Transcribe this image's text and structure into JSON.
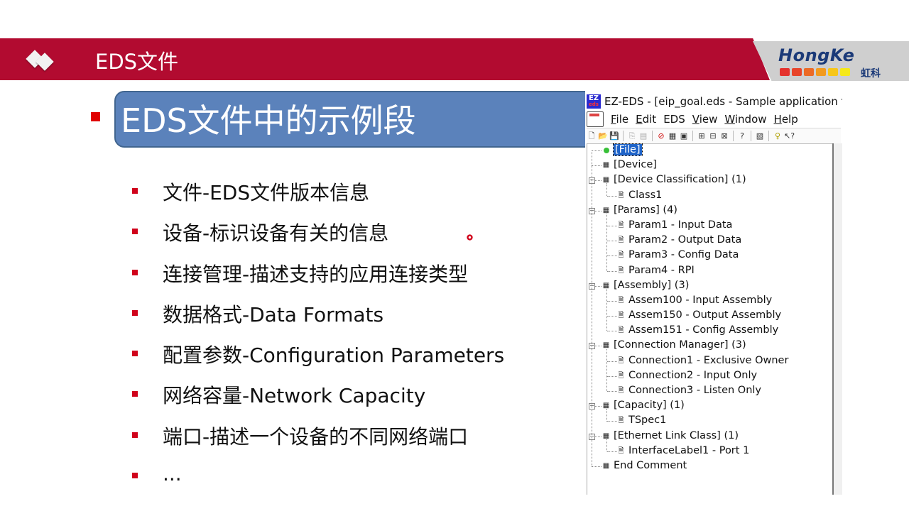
{
  "slide": {
    "section_title": "EDS文件",
    "heading": "EDS文件中的示例段",
    "bullets": [
      "文件-EDS文件版本信息",
      "设备-标识设备有关的信息",
      "连接管理-描述支持的应用连接类型",
      "数据格式-Data Formats",
      "配置参数-Configuration Parameters",
      "网络容量-Network Capacity",
      "端口-描述一个设备的不同网络端口",
      "..."
    ],
    "logo": {
      "text": "HongKe",
      "cn_text": "虹科",
      "bar_colors": [
        "#e5322d",
        "#e8452a",
        "#ec6a25",
        "#f29a1e",
        "#f7c61a",
        "#f5e91a"
      ]
    },
    "colors": {
      "banner": "#b20b30",
      "heading_box": "#5b82bb",
      "bullet": "#d0021b"
    }
  },
  "window": {
    "app_icon_top": "EZ",
    "app_icon_bottom": "eds",
    "title": "EZ-EDS - [eip_goal.eds - Sample application for",
    "menu": [
      {
        "key": "F",
        "rest": "ile"
      },
      {
        "key": "E",
        "rest": "dit"
      },
      {
        "key": "",
        "rest": "EDS"
      },
      {
        "key": "V",
        "rest": "iew"
      },
      {
        "key": "W",
        "rest": "indow"
      },
      {
        "key": "H",
        "rest": "elp"
      }
    ],
    "toolbar": [
      {
        "name": "new-file-icon",
        "glyph": "🗋",
        "enabled": true
      },
      {
        "name": "open-folder-icon",
        "glyph": "📂",
        "enabled": true
      },
      {
        "name": "save-icon",
        "glyph": "💾",
        "enabled": true
      },
      {
        "name": "copy-icon",
        "glyph": "⎘",
        "enabled": false
      },
      {
        "name": "paste-icon",
        "glyph": "▤",
        "enabled": false
      },
      {
        "name": "delete-icon",
        "glyph": "⊘",
        "enabled": true
      },
      {
        "name": "copy-item-icon",
        "glyph": "▦",
        "enabled": true
      },
      {
        "name": "paste-item-icon",
        "glyph": "▣",
        "enabled": true
      },
      {
        "name": "add-class-icon",
        "glyph": "⊞",
        "enabled": true
      },
      {
        "name": "add-item-icon",
        "glyph": "⊟",
        "enabled": true
      },
      {
        "name": "add-vendor-icon",
        "glyph": "⊠",
        "enabled": true
      },
      {
        "name": "help-topic-icon",
        "glyph": "?",
        "enabled": true
      },
      {
        "name": "view-icon",
        "glyph": "▧",
        "enabled": true
      },
      {
        "name": "about-icon",
        "glyph": "♀",
        "enabled": true
      },
      {
        "name": "context-help-icon",
        "glyph": "↖?",
        "enabled": true
      }
    ],
    "tree": [
      {
        "label": "[File]",
        "level": 0,
        "selected": true,
        "type": "file"
      },
      {
        "label": "[Device]",
        "level": 0,
        "type": "section"
      },
      {
        "label": "[Device Classification] (1)",
        "level": 0,
        "expandable": true,
        "type": "section"
      },
      {
        "label": "Class1",
        "level": 1,
        "type": "item"
      },
      {
        "label": "[Params] (4)",
        "level": 0,
        "expandable": true,
        "type": "section"
      },
      {
        "label": "Param1 - Input Data",
        "level": 1,
        "type": "item"
      },
      {
        "label": "Param2 - Output Data",
        "level": 1,
        "type": "item"
      },
      {
        "label": "Param3 - Config Data",
        "level": 1,
        "type": "item"
      },
      {
        "label": "Param4 - RPI",
        "level": 1,
        "type": "item"
      },
      {
        "label": "[Assembly] (3)",
        "level": 0,
        "expandable": true,
        "type": "section"
      },
      {
        "label": "Assem100 - Input Assembly",
        "level": 1,
        "type": "item"
      },
      {
        "label": "Assem150 - Output Assembly",
        "level": 1,
        "type": "item"
      },
      {
        "label": "Assem151 - Config Assembly",
        "level": 1,
        "type": "item"
      },
      {
        "label": "[Connection Manager] (3)",
        "level": 0,
        "expandable": true,
        "type": "section"
      },
      {
        "label": "Connection1 - Exclusive Owner",
        "level": 1,
        "type": "item"
      },
      {
        "label": "Connection2 - Input Only",
        "level": 1,
        "type": "item"
      },
      {
        "label": "Connection3 - Listen Only",
        "level": 1,
        "type": "item"
      },
      {
        "label": "[Capacity] (1)",
        "level": 0,
        "expandable": true,
        "type": "section"
      },
      {
        "label": "TSpec1",
        "level": 1,
        "type": "item"
      },
      {
        "label": "[Ethernet Link Class] (1)",
        "level": 0,
        "expandable": true,
        "type": "section"
      },
      {
        "label": "InterfaceLabel1 - Port 1",
        "level": 1,
        "type": "item"
      },
      {
        "label": "End Comment",
        "level": 0,
        "type": "section"
      }
    ]
  }
}
